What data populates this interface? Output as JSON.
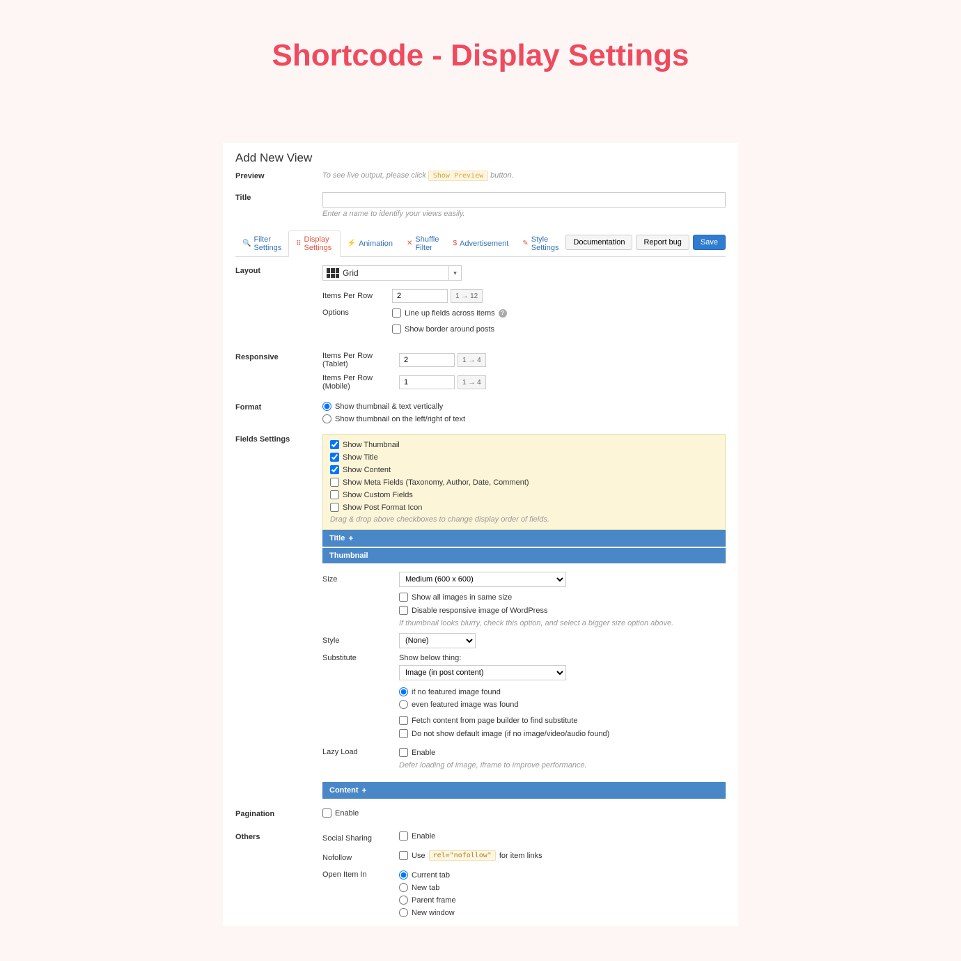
{
  "page_heading": "Shortcode - Display Settings",
  "panel_heading": "Add New View",
  "preview": {
    "label": "Preview",
    "hint_prefix": "To see live output, please click ",
    "hint_button": "Show Preview",
    "hint_suffix": " button."
  },
  "title_section": {
    "label": "Title",
    "value": "",
    "hint": "Enter a name to identify your views easily."
  },
  "tabs": [
    {
      "label": "Filter Settings",
      "icon": "🔍",
      "icon_color": "#e8503e"
    },
    {
      "label": "Display Settings",
      "icon": "⠿",
      "active": true
    },
    {
      "label": "Animation",
      "icon": "⚡",
      "icon_color": "#f0a030"
    },
    {
      "label": "Shuffle Filter",
      "icon": "✕",
      "icon_color": "#e8503e"
    },
    {
      "label": "Advertisement",
      "icon": "$",
      "icon_color": "#e8503e"
    },
    {
      "label": "Style Settings",
      "icon": "✎",
      "icon_color": "#e8503e"
    }
  ],
  "action_buttons": {
    "documentation": "Documentation",
    "report_bug": "Report bug",
    "save": "Save"
  },
  "layout": {
    "label": "Layout",
    "selected": "Grid",
    "items_per_row": {
      "label": "Items Per Row",
      "value": "2",
      "range": "1 → 12"
    },
    "options_label": "Options",
    "option_lineup": "Line up fields across items",
    "option_border": "Show border around posts"
  },
  "responsive": {
    "label": "Responsive",
    "tablet": {
      "label": "Items Per Row (Tablet)",
      "value": "2",
      "range": "1 → 4"
    },
    "mobile": {
      "label": "Items Per Row (Mobile)",
      "value": "1",
      "range": "1 → 4"
    }
  },
  "format": {
    "label": "Format",
    "opt_vertical": "Show thumbnail & text vertically",
    "opt_side": "Show thumbnail on the left/right of text"
  },
  "fields_settings": {
    "label": "Fields Settings",
    "show_thumbnail": "Show Thumbnail",
    "show_title": "Show Title",
    "show_content": "Show Content",
    "show_meta": "Show Meta Fields (Taxonomy, Author, Date, Comment)",
    "show_custom": "Show Custom Fields",
    "show_format_icon": "Show Post Format Icon",
    "hint": "Drag & drop above checkboxes to change display order of fields."
  },
  "bands": {
    "title": "Title",
    "thumbnail": "Thumbnail",
    "content": "Content"
  },
  "thumbnail": {
    "size_label": "Size",
    "size_value": "Medium (600 x 600)",
    "show_same_size": "Show all images in same size",
    "disable_responsive": "Disable responsive image of WordPress",
    "disable_responsive_hint": "If thumbnail looks blurry, check this option, and select a bigger size option above.",
    "style_label": "Style",
    "style_value": "(None)",
    "substitute_label": "Substitute",
    "substitute_intro": "Show below thing:",
    "substitute_value": "Image (in post content)",
    "sub_radio_no_featured": "if no featured image found",
    "sub_radio_even": "even featured image was found",
    "fetch_builder": "Fetch content from page builder to find substitute",
    "no_default": "Do not show default image (if no image/video/audio found)",
    "lazy_label": "Lazy Load",
    "lazy_enable": "Enable",
    "lazy_hint": "Defer loading of image, iframe to improve performance."
  },
  "pagination": {
    "label": "Pagination",
    "enable": "Enable"
  },
  "others": {
    "label": "Others",
    "social_label": "Social Sharing",
    "social_enable": "Enable",
    "nofollow_label": "Nofollow",
    "nofollow_text_prefix": "Use ",
    "nofollow_code": "rel=\"nofollow\"",
    "nofollow_text_suffix": " for item links",
    "open_in_label": "Open Item In",
    "open_current": "Current tab",
    "open_new_tab": "New tab",
    "open_parent": "Parent frame",
    "open_new_window": "New window"
  }
}
